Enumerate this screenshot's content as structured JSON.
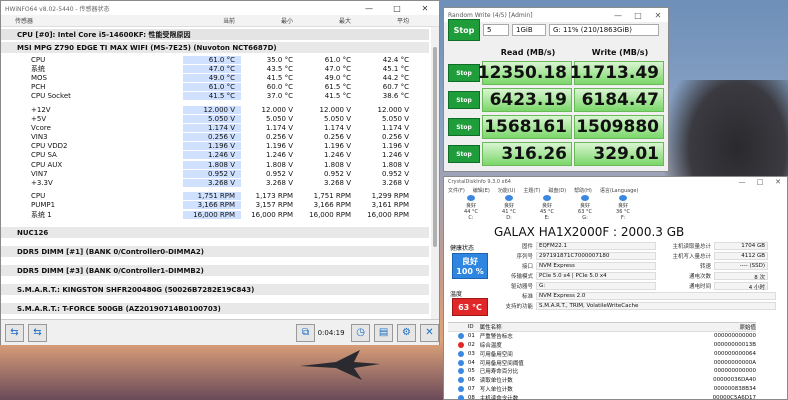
{
  "hwinfo": {
    "title": "HWiNFO64 v8.02-5440 - 传感器状态",
    "window_controls": [
      "—",
      "□",
      "✕"
    ],
    "columns": [
      "传感器",
      "当前",
      "最小",
      "最大",
      "平均"
    ],
    "top_group": "CPU [#0]: Intel Core i5-14600KF: 性能受限原因",
    "board_group": "MSI MPG Z790 EDGE TI MAX WIFI (MS-7E25) (Nuvoton NCT6687D)",
    "rows": [
      {
        "name": "CPU",
        "cur": "61.0 °C",
        "min": "35.0 °C",
        "max": "61.0 °C",
        "avg": "42.4 °C"
      },
      {
        "name": "系统",
        "cur": "47.0 °C",
        "min": "43.5 °C",
        "max": "47.0 °C",
        "avg": "45.1 °C"
      },
      {
        "name": "MOS",
        "cur": "49.0 °C",
        "min": "41.5 °C",
        "max": "49.0 °C",
        "avg": "44.2 °C"
      },
      {
        "name": "PCH",
        "cur": "61.0 °C",
        "min": "60.0 °C",
        "max": "61.5 °C",
        "avg": "60.7 °C"
      },
      {
        "name": "CPU Socket",
        "cur": "41.5 °C",
        "min": "37.0 °C",
        "max": "41.5 °C",
        "avg": "38.6 °C"
      },
      {
        "name": "+12V",
        "cur": "12.000 V",
        "min": "12.000 V",
        "max": "12.000 V",
        "avg": "12.000 V"
      },
      {
        "name": "+5V",
        "cur": "5.050 V",
        "min": "5.050 V",
        "max": "5.050 V",
        "avg": "5.050 V"
      },
      {
        "name": "Vcore",
        "cur": "1.174 V",
        "min": "1.174 V",
        "max": "1.174 V",
        "avg": "1.174 V"
      },
      {
        "name": "VIN3",
        "cur": "0.256 V",
        "min": "0.256 V",
        "max": "0.256 V",
        "avg": "0.256 V"
      },
      {
        "name": "CPU VDD2",
        "cur": "1.196 V",
        "min": "1.196 V",
        "max": "1.196 V",
        "avg": "1.196 V"
      },
      {
        "name": "CPU SA",
        "cur": "1.246 V",
        "min": "1.246 V",
        "max": "1.246 V",
        "avg": "1.246 V"
      },
      {
        "name": "CPU AUX",
        "cur": "1.808 V",
        "min": "1.808 V",
        "max": "1.808 V",
        "avg": "1.808 V"
      },
      {
        "name": "VIN7",
        "cur": "0.952 V",
        "min": "0.952 V",
        "max": "0.952 V",
        "avg": "0.952 V"
      },
      {
        "name": "+3.3V",
        "cur": "3.268 V",
        "min": "3.268 V",
        "max": "3.268 V",
        "avg": "3.268 V"
      },
      {
        "name": "CPU",
        "cur": "1,751 RPM",
        "min": "1,173 RPM",
        "max": "1,751 RPM",
        "avg": "1,299 RPM"
      },
      {
        "name": "PUMP1",
        "cur": "3,166 RPM",
        "min": "3,157 RPM",
        "max": "3,166 RPM",
        "avg": "3,161 RPM"
      },
      {
        "name": "系统 1",
        "cur": "16,000 RPM",
        "min": "16,000 RPM",
        "max": "16,000 RPM",
        "avg": "16,000 RPM"
      }
    ],
    "groups_below": [
      "NUC126",
      "DDR5 DIMM [#1] (BANK 0/Controller0-DIMMA2)",
      "DDR5 DIMM [#3] (BANK 0/Controller1-DIMMB2)",
      "S.M.A.R.T.: KINGSTON SHFR200480G (50026B7282E19C843)",
      "S.M.A.R.T.: T-FORCE 500GB (AZ20190714B0100703)"
    ],
    "elapsed": "0:04:19"
  },
  "random_write": {
    "title": "Random Write (4/5) [Admin]",
    "stop_label": "Stop",
    "count": "5",
    "size": "1GiB",
    "drive": "G: 11% (210/1863GiB)",
    "read_header": "Read (MB/s)",
    "write_header": "Write (MB/s)",
    "results": [
      {
        "label": "Stop",
        "read": "12350.18",
        "write": "11713.49"
      },
      {
        "label": "Stop",
        "read": "6423.19",
        "write": "6184.47"
      },
      {
        "label": "Stop",
        "read": "1568161",
        "write": "1509880"
      },
      {
        "label": "Stop",
        "read": "316.26",
        "write": "329.01"
      }
    ]
  },
  "crystal": {
    "title": "CrystalDiskInfo 9.3.0 x64",
    "menu": [
      "文件(F)",
      "编辑(E)",
      "功能(U)",
      "主题(T)",
      "磁盘(D)",
      "帮助(H)",
      "语言(Language)"
    ],
    "drives": [
      {
        "status": "良好",
        "temp": "44 °C",
        "letter": "C:"
      },
      {
        "status": "良好",
        "temp": "41 °C",
        "letter": "D:"
      },
      {
        "status": "良好",
        "temp": "45 °C",
        "letter": "E:"
      },
      {
        "status": "良好",
        "temp": "63 °C",
        "letter": "G:"
      },
      {
        "status": "良好",
        "temp": "36 °C",
        "letter": "F:"
      }
    ],
    "model": "GALAX HA1X2000F : 2000.3 GB",
    "health_label": "健康状态",
    "health_status": "良好",
    "health_pct": "100 %",
    "temp_label": "温度",
    "temp_value": "63 °C",
    "info": [
      {
        "k": "固件",
        "v": "EQFM22.1",
        "k2": "主机读取量总计",
        "v2": "1704 GB"
      },
      {
        "k": "序列号",
        "v": "297191871C7000007180",
        "k2": "主机写入量总计",
        "v2": "4112 GB"
      },
      {
        "k": "接口",
        "v": "NVM Express",
        "k2": "转速",
        "v2": "---- (SSD)"
      },
      {
        "k": "传输模式",
        "v": "PCIe 5.0 x4 | PCIe 5.0 x4",
        "k2": "通电次数",
        "v2": "8 次"
      },
      {
        "k": "驱动器号",
        "v": "G:",
        "k2": "通电时间",
        "v2": "4 小时"
      }
    ],
    "standard_label": "标准",
    "standard": "NVM Express 2.0",
    "features_label": "支持的功能",
    "features": "S.M.A.R.T., TRIM, VolatileWriteCache",
    "attr_header": {
      "id": "ID",
      "name": "属性名称",
      "raw": "原始值"
    },
    "attributes": [
      {
        "id": "01",
        "name": "严重警告标志",
        "raw": "000000000000"
      },
      {
        "id": "02",
        "name": "综合温度",
        "raw": "00000000013B"
      },
      {
        "id": "03",
        "name": "可用备用空间",
        "raw": "000000000064"
      },
      {
        "id": "04",
        "name": "可用备用空间阈值",
        "raw": "00000000000A"
      },
      {
        "id": "05",
        "name": "已用寿命百分比",
        "raw": "000000000000"
      },
      {
        "id": "06",
        "name": "读取单位计数",
        "raw": "00000036DA40"
      },
      {
        "id": "07",
        "name": "写入单位计数",
        "raw": "000000838B34"
      },
      {
        "id": "08",
        "name": "主机读命令计数",
        "raw": "00000C5A6D17"
      },
      {
        "id": "09",
        "name": "主机写命令计数",
        "raw": "00000BA7C1F3"
      }
    ]
  }
}
